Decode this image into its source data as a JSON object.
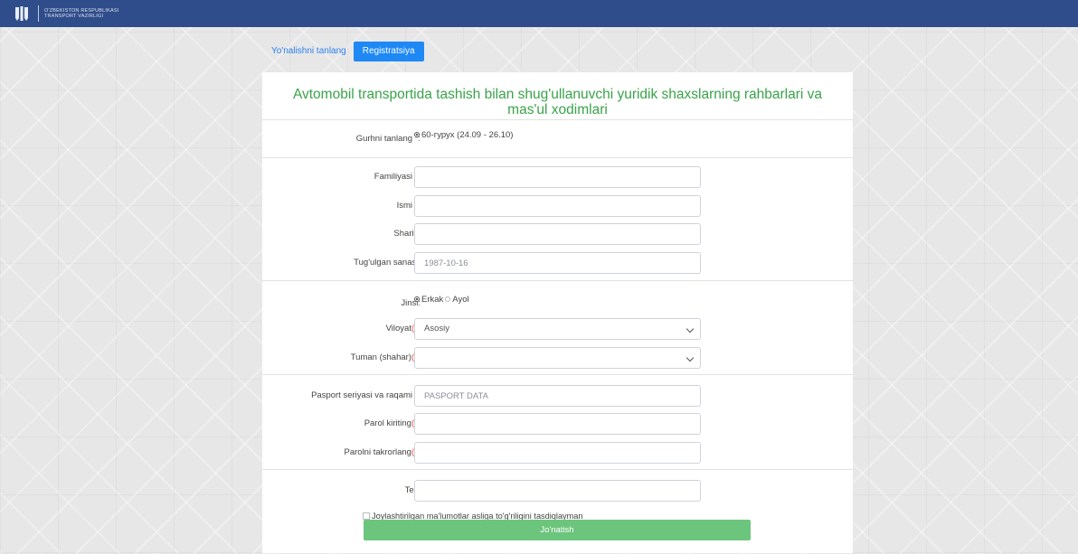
{
  "header": {
    "brand_line1": "O'ZBEKISTON RESPUBLIKASI",
    "brand_line2": "TRANSPORT VAZIRLIGI"
  },
  "tabs": {
    "choose_direction": "Yo'nalishni tanlang",
    "registration": "Registratsiya"
  },
  "form": {
    "title": "Avtomobil transportida tashish bilan shug'ullanuvchi yuridik shaxslarning rahbarlari va mas'ul xodimlari",
    "group": {
      "label": "Gurhni tanlang",
      "required_mark": " *",
      "colon": ":",
      "option": "60-гурух (24.09 - 26.10)"
    },
    "surname": {
      "label": "Familiyasi",
      "required_mark": " *",
      "colon": ":",
      "value": ""
    },
    "name": {
      "label": "Ismi",
      "required_mark": " *",
      "colon": ":",
      "value": ""
    },
    "patronymic": {
      "label": "Sharifi:",
      "value": ""
    },
    "birth_date": {
      "label": "Tug'ulgan sanasi:",
      "placeholder": "1987-10-16"
    },
    "gender": {
      "label": "Jinsi:",
      "option_male": "Erkak",
      "option_female": "Ayol"
    },
    "region": {
      "label": "Viloyat",
      "required_mark": "(*)",
      "value": "Asosiy"
    },
    "district": {
      "label": "Tuman (shahar)",
      "required_mark": "(*)",
      "value": ""
    },
    "passport": {
      "label": "Pasport seriyasi va raqami",
      "required_mark": " *",
      "colon": ":",
      "placeholder": "PASPORT DATA"
    },
    "password": {
      "label": "Parol kiriting",
      "required_mark": "(*)"
    },
    "password_repeat": {
      "label": "Parolni takrorlang",
      "required_mark": "(*)"
    },
    "phone": {
      "label": "Tel.:",
      "value": ""
    },
    "confirm_text": "Joylashtirilgan ma'lumotlar asliga to'g'riligini tasdiqlayman",
    "submit_label": "Jo'natish"
  },
  "colors": {
    "header_bg": "#2f4d8a",
    "accent_blue": "#1e88f5",
    "title_green": "#3aa34a",
    "submit_green": "#6cc57c",
    "required_red": "#e05050"
  },
  "icons": {
    "logo": "ministry-emblem-icon",
    "select_arrow": "chevron-down-icon"
  }
}
